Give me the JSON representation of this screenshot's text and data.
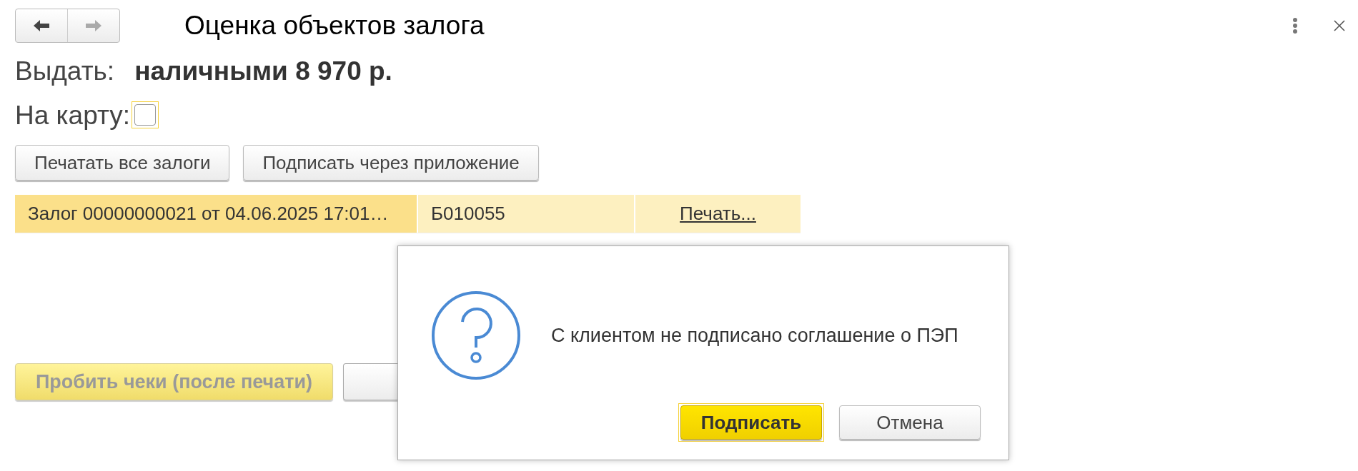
{
  "window": {
    "title": "Оценка объектов залога"
  },
  "issue": {
    "label": "Выдать:",
    "value": "наличными 8 970 р."
  },
  "to_card": {
    "label": "На карту:",
    "checked": false
  },
  "actions": [
    "Печатать все залоги",
    "Подписать через приложение"
  ],
  "table": {
    "rows": [
      {
        "cells": [
          "Залог 00000000021 от 04.06.2025 17:01…",
          "Б010055"
        ],
        "link": "Печать...",
        "selected": true
      }
    ]
  },
  "bottom_buttons": [
    {
      "label": "Пробить чеки (после печати)",
      "disabled": true
    }
  ],
  "dialog": {
    "message": "С клиентом не подписано соглашение о ПЭП",
    "buttons": [
      {
        "label": "Подписать",
        "default": true
      },
      {
        "label": "Отмена",
        "default": false
      }
    ]
  }
}
